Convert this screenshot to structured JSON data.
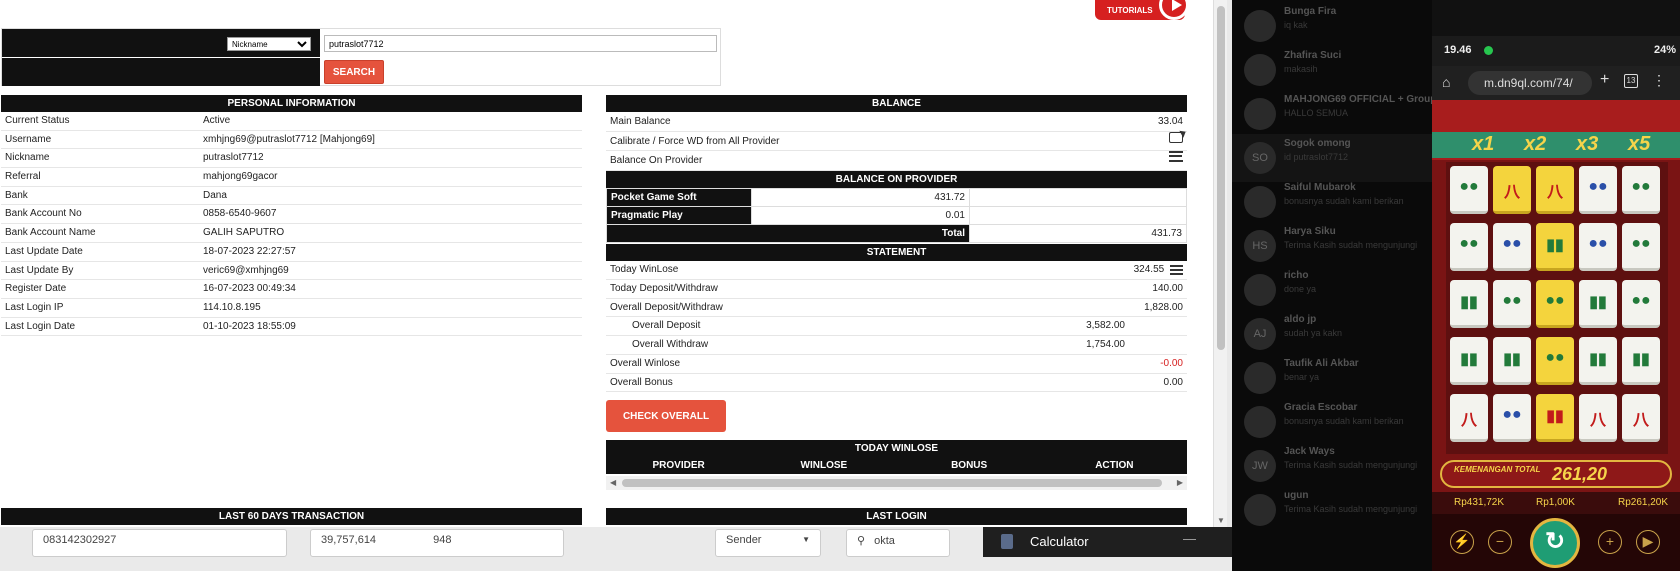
{
  "video_badge": {
    "top": "VIDEO",
    "bottom": "TUTORIALS"
  },
  "search": {
    "select_value": "Nickname",
    "input_value": "putraslot7712",
    "button_label": "SEARCH"
  },
  "personal": {
    "title": "PERSONAL INFORMATION",
    "rows": [
      {
        "label": "Current Status",
        "value": "Active"
      },
      {
        "label": "Username",
        "value": "xmhjng69@putraslot7712  [Mahjong69]"
      },
      {
        "label": "Nickname",
        "value": "putraslot7712"
      },
      {
        "label": "Referral",
        "value": "mahjong69gacor"
      },
      {
        "label": "Bank",
        "value": "Dana"
      },
      {
        "label": "Bank Account No",
        "value": "0858-6540-9607"
      },
      {
        "label": "Bank Account Name",
        "value": "GALIH SAPUTRO"
      },
      {
        "label": "Last Update Date",
        "value": "18-07-2023 22:27:57"
      },
      {
        "label": "Last Update By",
        "value": "veric69@xmhjng69"
      },
      {
        "label": "Register Date",
        "value": "16-07-2023 00:49:34"
      },
      {
        "label": "Last Login IP",
        "value": "114.10.8.195"
      },
      {
        "label": "Last Login Date",
        "value": "01-10-2023 18:55:09"
      }
    ]
  },
  "balance": {
    "title": "BALANCE",
    "main_label": "Main Balance",
    "main_value": "33.04",
    "calibrate_label": "Calibrate / Force WD from All Provider",
    "on_provider_label": "Balance On Provider",
    "on_provider_title": "BALANCE ON PROVIDER",
    "providers": [
      {
        "name": "Pocket Game Soft",
        "value": "431.72"
      },
      {
        "name": "Pragmatic Play",
        "value": "0.01"
      }
    ],
    "total_label": "Total",
    "total_value": "431.73"
  },
  "statement": {
    "title": "STATEMENT",
    "today_winlose_label": "Today WinLose",
    "today_winlose_value": "324.55",
    "today_dw_label": "Today Deposit/Withdraw",
    "today_dw_value": "140.00",
    "overall_dw_label": "Overall Deposit/Withdraw",
    "overall_dw_value": "1,828.00",
    "overall_deposit_label": "Overall Deposit",
    "overall_deposit_value": "3,582.00",
    "overall_withdraw_label": "Overall Withdraw",
    "overall_withdraw_value": "1,754.00",
    "overall_winlose_label": "Overall Winlose",
    "overall_winlose_value": "-0.00",
    "overall_bonus_label": "Overall Bonus",
    "overall_bonus_value": "0.00",
    "check_button": "CHECK OVERALL"
  },
  "today_winlose": {
    "title": "TODAY WINLOSE",
    "columns": [
      "PROVIDER",
      "WINLOSE",
      "BONUS",
      "ACTION"
    ]
  },
  "last60_title": "LAST 60 DAYS TRANSACTION",
  "last_login_title": "LAST LOGIN",
  "underlying": {
    "phone": "083142302927",
    "amount": "39,757,614",
    "count": "948",
    "sender": "Sender",
    "search_value": "okta"
  },
  "calculator": {
    "title": "Calculator",
    "minimize": "—"
  },
  "chat": [
    {
      "name": "Bunga Fira",
      "msg": "iq kak",
      "avatar": ""
    },
    {
      "name": "Zhafira Suci",
      "msg": "makasih",
      "avatar": ""
    },
    {
      "name": "MAHJONG69 OFFICIAL + Group Help",
      "msg": "HALLO SEMUA",
      "avatar": ""
    },
    {
      "name": "Sogok omong",
      "msg": "id putraslot7712",
      "avatar": "SO"
    },
    {
      "name": "Saiful Mubarok",
      "msg": "bonusnya sudah kami berikan",
      "avatar": ""
    },
    {
      "name": "Harya Siku",
      "msg": "Terima Kasih sudah mengunjungi",
      "avatar": "HS"
    },
    {
      "name": "richo",
      "msg": "done ya",
      "avatar": ""
    },
    {
      "name": "aldo jp",
      "msg": "sudah ya kakn",
      "avatar": "AJ"
    },
    {
      "name": "Taufik Ali Akbar",
      "msg": "benar ya",
      "avatar": ""
    },
    {
      "name": "Gracia Escobar",
      "msg": "bonusnya sudah kami berikan",
      "avatar": ""
    },
    {
      "name": "Jack Ways",
      "msg": "Terima Kasih sudah mengunjungi",
      "avatar": "JW"
    },
    {
      "name": "ugun",
      "msg": "Terima Kasih sudah mengunjungi",
      "avatar": ""
    }
  ],
  "phone": {
    "time": "19.46",
    "battery": "24%",
    "url": "m.dn9ql.com/74/",
    "tab_count": "13",
    "multipliers": [
      "x1",
      "x2",
      "x3",
      "x5"
    ],
    "win_label": "KEMENANGAN TOTAL",
    "win_value": "261,20",
    "stat_balance": "Rp431,72K",
    "stat_bet": "Rp1,00K",
    "stat_win": "Rp261,20K",
    "turbo_label": "TURBO",
    "auto_label": "AUTO"
  },
  "colors": {
    "accent": "#e5533d",
    "header_bg": "#111111",
    "negative": "#d62020"
  }
}
